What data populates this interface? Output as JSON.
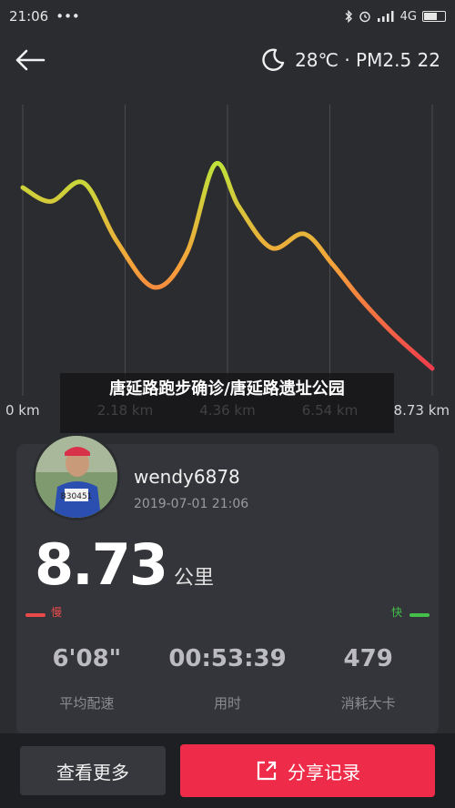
{
  "status_bar": {
    "time": "21:06",
    "dots": "•••",
    "network": "4G",
    "icons": [
      "bluetooth-icon",
      "alarm-icon",
      "signal-icon",
      "battery-icon"
    ]
  },
  "header": {
    "back_icon": "arrow-left-icon",
    "weather_icon": "moon-icon",
    "weather_text": "28℃ · PM2.5 22"
  },
  "chart_data": {
    "type": "line",
    "x_tick_labels": [
      "0 km",
      "2.18 km",
      "4.36 km",
      "6.54 km",
      "8.73 km"
    ],
    "x": [
      0,
      0.6,
      1.3,
      2.0,
      2.8,
      3.5,
      4.1,
      4.6,
      5.3,
      6.0,
      6.6,
      7.2,
      7.9,
      8.73
    ],
    "y": [
      0.78,
      0.72,
      0.8,
      0.55,
      0.35,
      0.5,
      0.88,
      0.7,
      0.52,
      0.58,
      0.45,
      0.3,
      0.15,
      0.0
    ],
    "y_meaning": "pace (higher = faster)",
    "gradient_colors": [
      "#f03c4c",
      "#f6a23a",
      "#bfe23a"
    ],
    "grid": "vertical"
  },
  "overlay_title": "唐延路跑步确诊/唐延路遗址公园",
  "user": {
    "name": "wendy6878",
    "datetime": "2019-07-01 21:06"
  },
  "summary": {
    "distance": "8.73",
    "distance_unit": "公里"
  },
  "pace_legend": {
    "slow": "慢",
    "fast": "快",
    "slow_color": "#e84a4a",
    "fast_color": "#44c04a"
  },
  "stats": [
    {
      "value": "6'08\"",
      "label": "平均配速"
    },
    {
      "value": "00:53:39",
      "label": "用时"
    },
    {
      "value": "479",
      "label": "消耗大卡"
    }
  ],
  "actions": {
    "more_label": "查看更多",
    "share_label": "分享记录",
    "share_icon": "share-icon"
  }
}
